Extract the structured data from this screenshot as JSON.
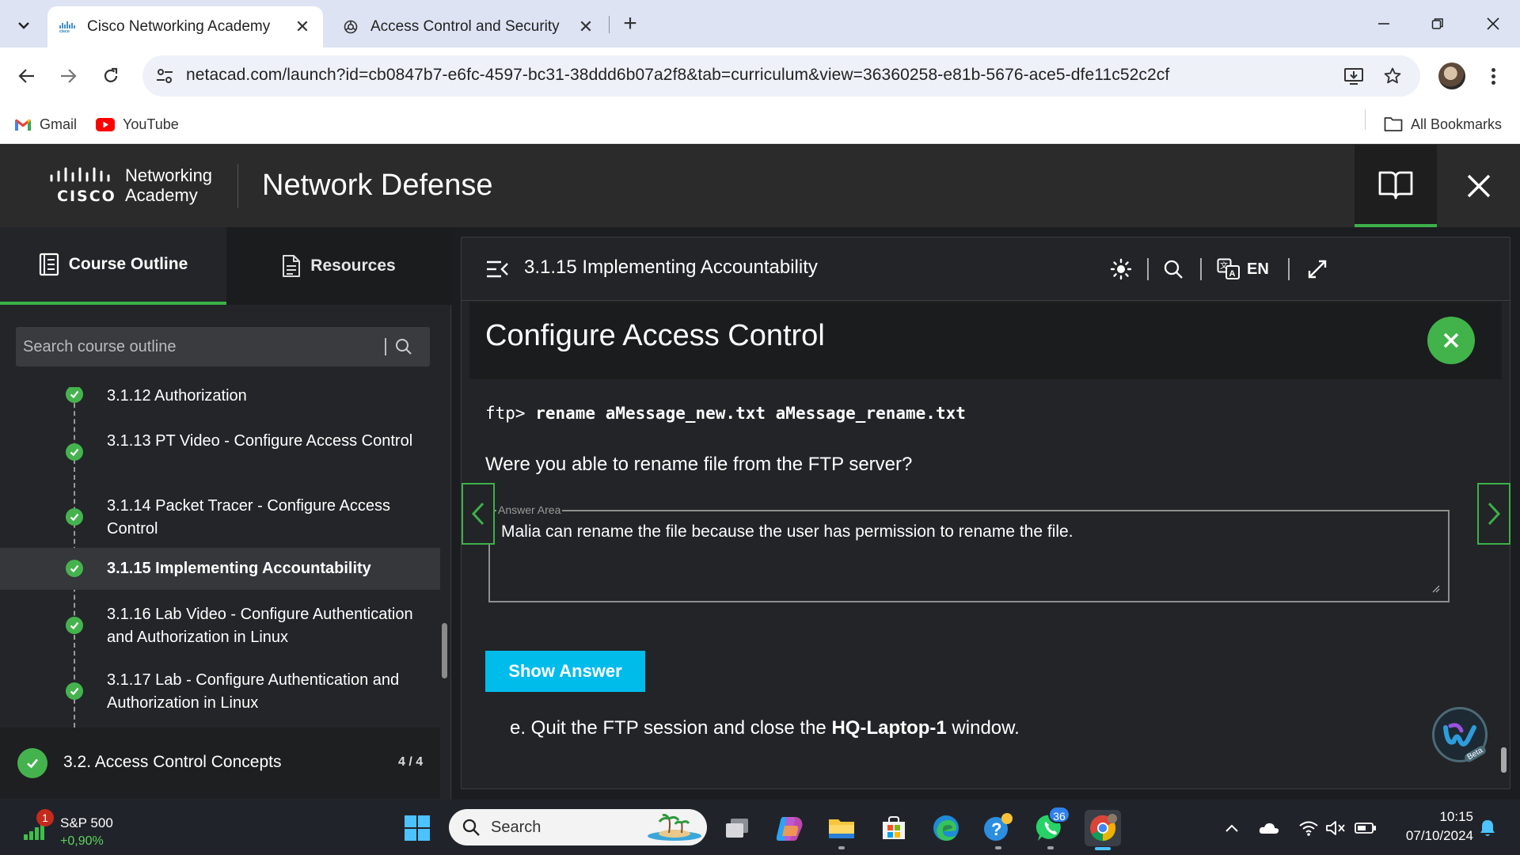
{
  "browser": {
    "tabs": [
      {
        "title": "Cisco Networking Academy",
        "favicon": "cisco-icon",
        "active": true
      },
      {
        "title": "Access Control and Security",
        "favicon": "chatgpt-icon",
        "active": false
      }
    ],
    "url": "netacad.com/launch?id=cb0847b7-e6fc-4597-bc31-38ddd6b07a2f8&tab=curriculum&view=36360258-e81b-5676-ace5-dfe11c52c2cf",
    "bookmarks": [
      {
        "label": "Gmail",
        "icon": "gmail-icon"
      },
      {
        "label": "YouTube",
        "icon": "youtube-icon"
      }
    ],
    "all_bookmarks": "All Bookmarks"
  },
  "header": {
    "logo_brand": "CISCO",
    "logo_line1": "Networking",
    "logo_line2": "Academy",
    "course_title": "Network Defense"
  },
  "sidebar": {
    "tabs": [
      {
        "label": "Course Outline",
        "icon": "outline-icon"
      },
      {
        "label": "Resources",
        "icon": "document-icon"
      }
    ],
    "search_placeholder": "Search course outline",
    "items": [
      {
        "label": "3.1.12 Authorization",
        "done": true
      },
      {
        "label": "3.1.13 PT Video - Configure Access Control",
        "done": true
      },
      {
        "label": "3.1.14 Packet Tracer - Configure Access Control",
        "done": true
      },
      {
        "label": "3.1.15 Implementing Accountability",
        "done": true,
        "active": true
      },
      {
        "label": "3.1.16 Lab Video - Configure Authentication and Authorization in Linux",
        "done": true
      },
      {
        "label": "3.1.17 Lab - Configure Authentication and Authorization in Linux",
        "done": true
      }
    ],
    "section": {
      "label": "3.2. Access Control Concepts",
      "count": "4 / 4"
    }
  },
  "content": {
    "page_title": "3.1.15 Implementing Accountability",
    "language": "EN",
    "activity_title": "Configure Access Control",
    "command_prompt": "ftp> ",
    "command": "rename aMessage_new.txt aMessage_rename.txt",
    "question": "Were you able to rename file from the FTP server?",
    "answer_legend": "Answer Area",
    "answer_text": "Malia can rename the file because the user has permission to rename the file.",
    "show_answer": "Show Answer",
    "step_prefix": "e. Quit the FTP session and close the ",
    "step_bold": "HQ-Laptop-1",
    "step_suffix": " window.",
    "assistant_badge": "Beta"
  },
  "taskbar": {
    "stock_name": "S&P 500",
    "stock_change": "+0,90%",
    "stock_badge": "1",
    "search_label": "Search",
    "whatsapp_badge": "36",
    "time": "10:15",
    "date": "07/10/2024"
  },
  "colors": {
    "accent_green": "#3db049",
    "show_answer_bg": "#00bceb",
    "panel_bg": "#222427"
  }
}
